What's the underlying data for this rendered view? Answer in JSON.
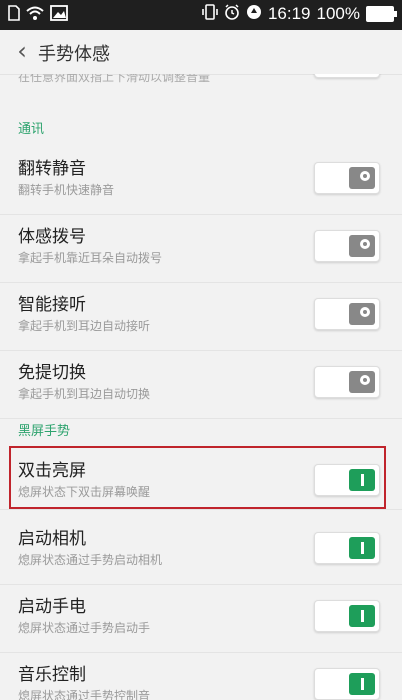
{
  "status": {
    "time": "16:19",
    "battery_text": "100%"
  },
  "header": {
    "back_icon": "‹",
    "title": "手势体感"
  },
  "partial": {
    "subtitle": "在任意界面双指上下滑动以调整音量"
  },
  "sections": {
    "comms": "通讯",
    "blackscreen": "黑屏手势"
  },
  "items": [
    {
      "title": "翻转静音",
      "subtitle": "翻转手机快速静音",
      "state": "off"
    },
    {
      "title": "体感拨号",
      "subtitle": "拿起手机靠近耳朵自动拨号",
      "state": "off"
    },
    {
      "title": "智能接听",
      "subtitle": "拿起手机到耳边自动接听",
      "state": "off"
    },
    {
      "title": "免提切换",
      "subtitle": "拿起手机到耳边自动切换",
      "state": "off"
    },
    {
      "title": "双击亮屏",
      "subtitle": "熄屏状态下双击屏幕唤醒",
      "state": "on"
    },
    {
      "title": "启动相机",
      "subtitle": "熄屏状态通过手势启动相机",
      "state": "on"
    },
    {
      "title": "启动手电",
      "subtitle": "熄屏状态通过手势启动手",
      "state": "on"
    },
    {
      "title": "音乐控制",
      "subtitle": "熄屏状态通过手势控制音",
      "state": "on"
    }
  ]
}
